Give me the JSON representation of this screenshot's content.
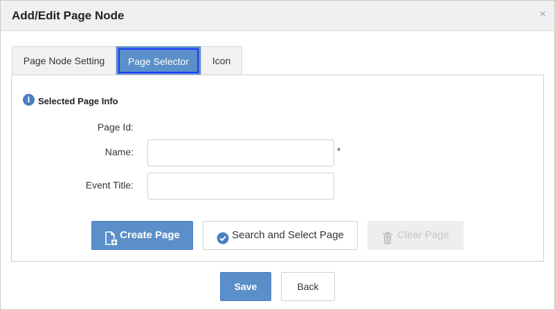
{
  "dialog": {
    "title": "Add/Edit Page Node",
    "close_glyph": "×"
  },
  "tabs": [
    {
      "label": "Page Node Setting",
      "active": false
    },
    {
      "label": "Page Selector",
      "active": true
    },
    {
      "label": "Icon",
      "active": false
    }
  ],
  "section": {
    "icon": "info-icon",
    "icon_glyph": "i",
    "title": "Selected Page Info"
  },
  "form": {
    "page_id_label": "Page Id:",
    "page_id_value": "",
    "name_label": "Name:",
    "name_value": "",
    "name_required_mark": "*",
    "event_title_label": "Event Title:",
    "event_title_value": ""
  },
  "actions": {
    "create_page_label": "Create Page",
    "create_page_icon": "file-add-icon",
    "search_select_label": "Search and Select Page",
    "search_select_icon": "check-circle-icon",
    "clear_page_label": "Clear Page",
    "clear_page_icon": "trash-icon",
    "clear_page_disabled": true
  },
  "footer": {
    "save_label": "Save",
    "back_label": "Back"
  },
  "colors": {
    "primary": "#5b8fc9",
    "tab_focus_outline": "#1f38ff",
    "header_bg": "#f0f0f0",
    "disabled_text": "#c4c4c4"
  }
}
